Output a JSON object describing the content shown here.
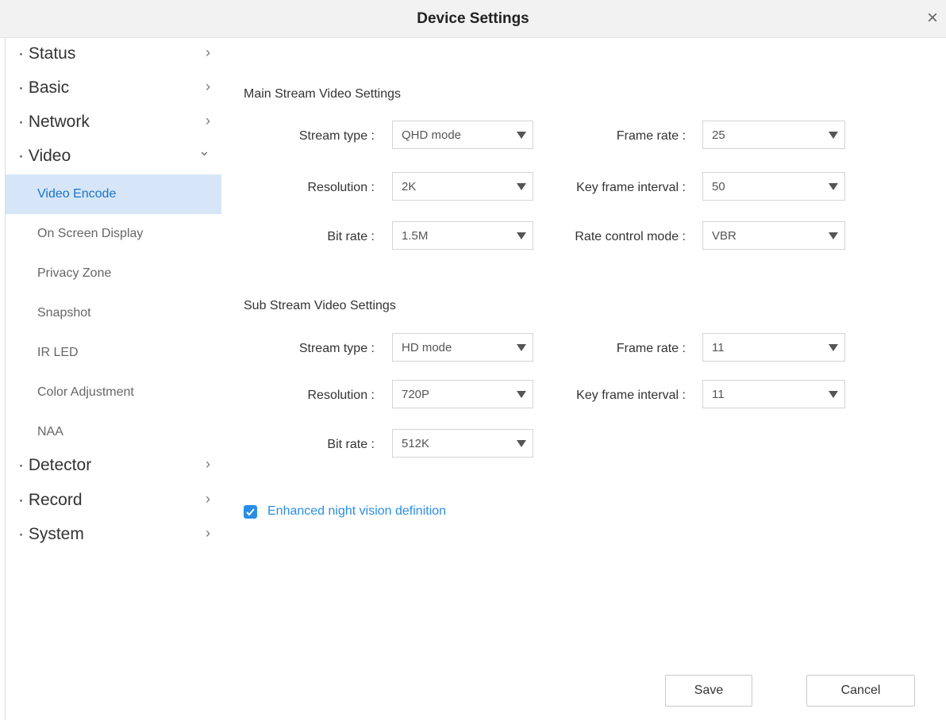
{
  "window": {
    "title": "Device Settings",
    "close_icon": "×"
  },
  "sidebar": {
    "chevron_right": "›",
    "chevron_down": "⌄",
    "items": [
      {
        "label": "· Status"
      },
      {
        "label": "· Basic"
      },
      {
        "label": "· Network"
      },
      {
        "label": "· Video"
      },
      {
        "label": "· Detector"
      },
      {
        "label": "· Record"
      },
      {
        "label": "· System"
      }
    ],
    "video_sub": [
      {
        "label": "Video Encode",
        "active": true
      },
      {
        "label": "On Screen Display"
      },
      {
        "label": "Privacy Zone"
      },
      {
        "label": "Snapshot"
      },
      {
        "label": "IR LED"
      },
      {
        "label": "Color Adjustment"
      },
      {
        "label": "NAA"
      }
    ]
  },
  "main_stream": {
    "title": "Main Stream Video Settings",
    "stream_type": {
      "label": "Stream type :",
      "value": "QHD mode"
    },
    "resolution": {
      "label": "Resolution :",
      "value": "2K"
    },
    "bit_rate": {
      "label": "Bit rate :",
      "value": "1.5M"
    },
    "frame_rate": {
      "label": "Frame rate :",
      "value": "25"
    },
    "key_frame_interval": {
      "label": "Key frame interval :",
      "value": "50"
    },
    "rate_control_mode": {
      "label": "Rate control mode :",
      "value": "VBR"
    }
  },
  "sub_stream": {
    "title": "Sub Stream Video Settings",
    "stream_type": {
      "label": "Stream type :",
      "value": "HD mode"
    },
    "resolution": {
      "label": "Resolution :",
      "value": "720P"
    },
    "bit_rate": {
      "label": "Bit rate :",
      "value": "512K"
    },
    "frame_rate": {
      "label": "Frame rate :",
      "value": "11"
    },
    "key_frame_interval": {
      "label": "Key frame interval :",
      "value": "11"
    }
  },
  "night_vision": {
    "label": "Enhanced night vision definition",
    "checked": true
  },
  "buttons": {
    "save": "Save",
    "cancel": "Cancel"
  },
  "colors": {
    "accent": "#2a8ee8",
    "active_bg": "#d6e6f8",
    "active_text": "#1a73c8"
  }
}
